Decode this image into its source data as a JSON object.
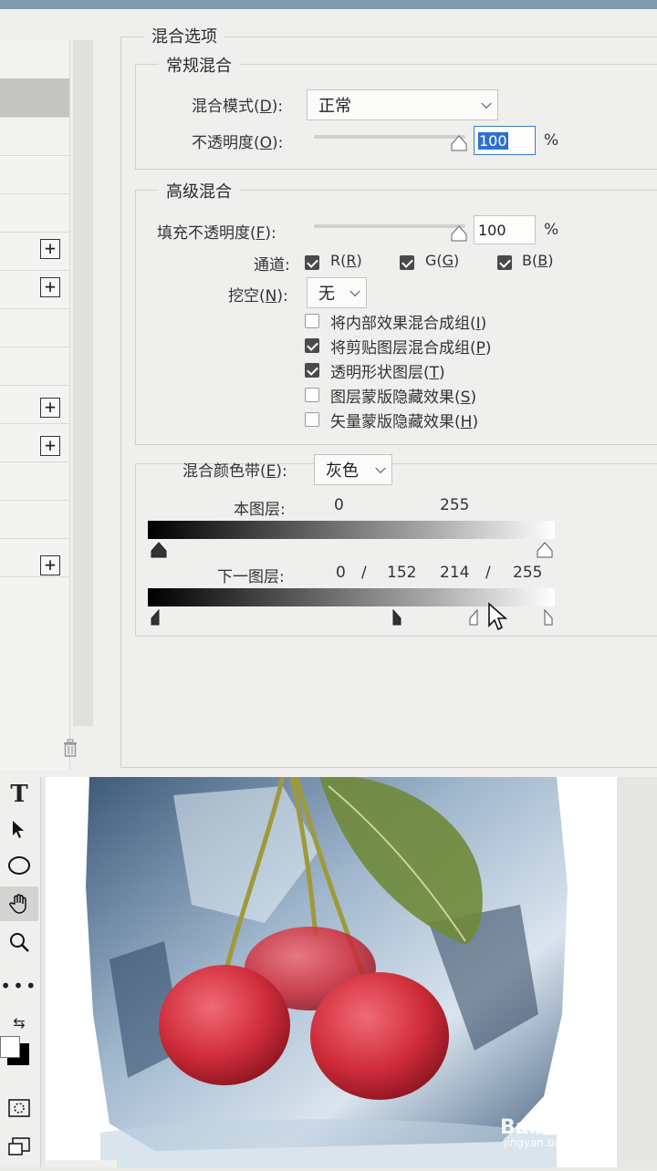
{
  "blending_options_title": "混合选项",
  "general_blending": {
    "title": "常规混合",
    "blend_mode_label": "混合模式(",
    "blend_mode_key": "D",
    "blend_mode_value": "正常",
    "opacity_label": "不透明度(",
    "opacity_key": "O",
    "opacity_value": "100",
    "opacity_unit": "%"
  },
  "advanced_blending": {
    "title": "高级混合",
    "fill_opacity_label": "填充不透明度(",
    "fill_opacity_key": "F",
    "fill_opacity_value": "100",
    "fill_opacity_unit": "%",
    "channels_label": "通道:",
    "channel_r": "R(",
    "channel_r_key": "R",
    "channel_g": "G(",
    "channel_g_key": "G",
    "channel_b": "B(",
    "channel_b_key": "B",
    "knockout_label": "挖空(",
    "knockout_key": "N",
    "knockout_value": "无",
    "options": [
      {
        "label": "将内部效果混合成组(",
        "key": "I",
        "checked": false
      },
      {
        "label": "将剪贴图层混合成组(",
        "key": "P",
        "checked": true
      },
      {
        "label": "透明形状图层(",
        "key": "T",
        "checked": true
      },
      {
        "label": "图层蒙版隐藏效果(",
        "key": "S",
        "checked": false
      },
      {
        "label": "矢量蒙版隐藏效果(",
        "key": "H",
        "checked": false
      }
    ]
  },
  "blend_if": {
    "label": "混合颜色带(",
    "key": "E",
    "value": "灰色",
    "this_layer_label": "本图层:",
    "this_layer_low": "0",
    "this_layer_high": "255",
    "underlying_label": "下一图层:",
    "underlying_low": "0",
    "underlying_sep1": "/",
    "underlying_low_split": "152",
    "underlying_high_split": "214",
    "underlying_sep2": "/",
    "underlying_high": "255"
  },
  "watermark": {
    "brand": "Bai经验",
    "url": "jingyan.baidu.com"
  }
}
